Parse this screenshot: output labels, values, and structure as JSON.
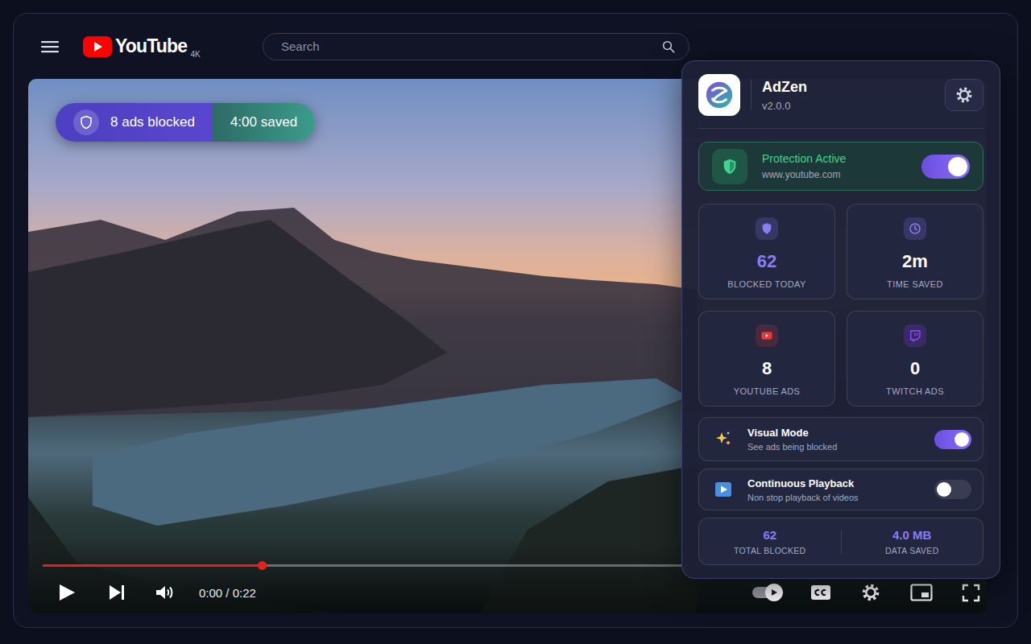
{
  "header": {
    "logo": "YouTube",
    "logo_badge": "4K",
    "search": {
      "placeholder": "Search"
    }
  },
  "overlay": {
    "blocked": "8 ads blocked",
    "saved": "4:00 saved"
  },
  "player": {
    "progress": 0.232,
    "time": "0:00 / 0:22",
    "autoplay": true
  },
  "popup": {
    "title": "AdZen",
    "version": "v2.0.0",
    "protection": {
      "title": "Protection Active",
      "site": "www.youtube.com",
      "on": true
    },
    "stats": [
      {
        "value": "62",
        "label": "BLOCKED TODAY",
        "highlighted": true,
        "color": "#8b7cf6"
      },
      {
        "value": "2m",
        "label": "TIME SAVED",
        "highlighted": false,
        "color": "#8b7cf6"
      },
      {
        "value": "8",
        "label": "YOUTUBE ADS",
        "highlighted": false,
        "color": "#e53935"
      },
      {
        "value": "0",
        "label": "TWITCH ADS",
        "highlighted": false,
        "color": "#9146ff"
      }
    ],
    "options": [
      {
        "title": "Visual Mode",
        "subtitle": "See ads being blocked",
        "on": true
      },
      {
        "title": "Continuous Playback",
        "subtitle": "Non stop playback of videos",
        "on": false
      }
    ],
    "totals": [
      {
        "value": "62",
        "label": "TOTAL BLOCKED"
      },
      {
        "value": "4.0 MB",
        "label": "DATA SAVED"
      }
    ]
  }
}
